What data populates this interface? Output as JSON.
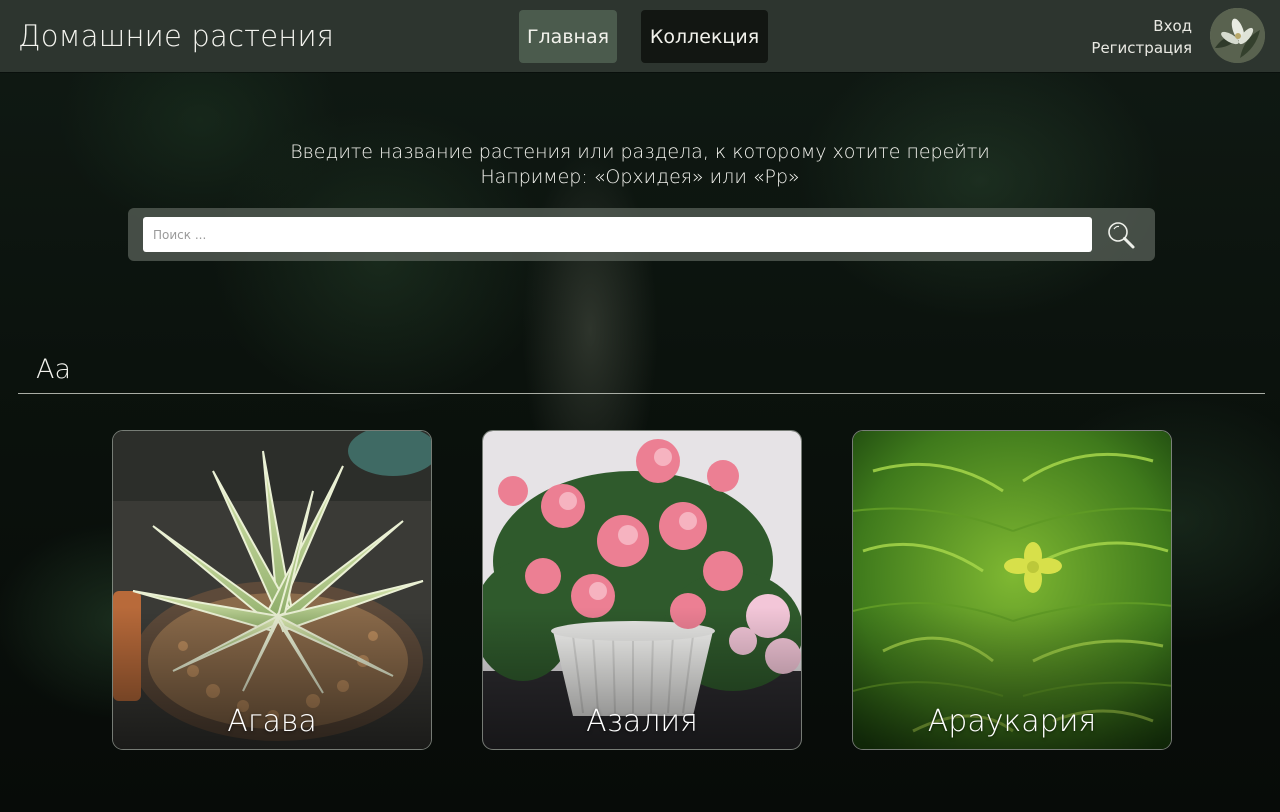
{
  "header": {
    "site_title": "Домашние растения",
    "nav": {
      "home_label": "Главная",
      "collection_label": "Коллекция"
    },
    "auth": {
      "login_label": "Вход",
      "register_label": "Регистрация"
    }
  },
  "search": {
    "hint_line1": "Введите название растения или раздела, к которому хотите перейти",
    "hint_line2": "Например: «Орхидея» или «Рр»",
    "placeholder": "Поиск ...",
    "value": "",
    "button_icon": "search-icon"
  },
  "section": {
    "letter": "Аа",
    "cards": [
      {
        "label": "Агава"
      },
      {
        "label": "Азалия"
      },
      {
        "label": "Араукария"
      }
    ]
  },
  "colors": {
    "header_bg": "#2d352f",
    "nav_active_bg": "#4b5b4d",
    "nav_dark_bg": "#121612"
  }
}
